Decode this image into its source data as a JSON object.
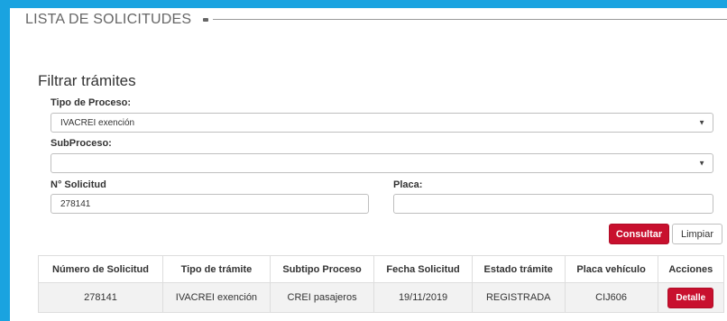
{
  "header": {
    "title": "LISTA DE SOLICITUDES"
  },
  "filter": {
    "heading": "Filtrar trámites",
    "tipo_proceso": {
      "label": "Tipo de Proceso:",
      "value": "IVACREI exención"
    },
    "subproceso": {
      "label": "SubProceso:",
      "value": ""
    },
    "solicitud": {
      "label": "N° Solicitud",
      "value": "278141"
    },
    "placa": {
      "label": "Placa:",
      "value": ""
    },
    "buttons": {
      "consultar": "Consultar",
      "limpiar": "Limpiar"
    }
  },
  "table": {
    "columns": [
      "Número de Solicitud",
      "Tipo de trámite",
      "Subtipo Proceso",
      "Fecha Solicitud",
      "Estado trámite",
      "Placa vehículo",
      "Acciones"
    ],
    "rows": [
      {
        "numero": "278141",
        "tipo": "IVACREI exención",
        "subtipo": "CREI pasajeros",
        "fecha": "19/11/2019",
        "estado": "REGISTRADA",
        "placa": "CIJ606",
        "accion": "Detalle"
      }
    ]
  },
  "colors": {
    "frame": "#1aa3e0",
    "primary": "#c8102e"
  },
  "icons": {
    "select_arrow": "triangle-down-icon"
  }
}
